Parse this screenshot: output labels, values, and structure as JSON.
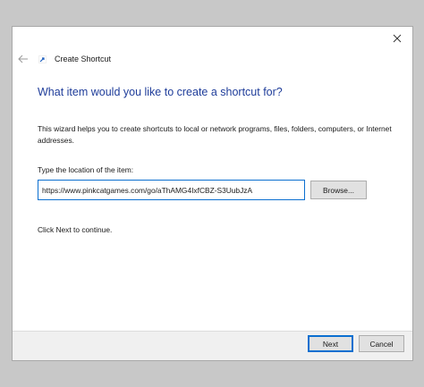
{
  "window": {
    "title": "Create Shortcut",
    "back_icon": "back-arrow-icon",
    "app_icon": "shortcut-icon",
    "close_icon": "close-icon"
  },
  "main": {
    "heading": "What item would you like to create a shortcut for?",
    "description": "This wizard helps you to create shortcuts to local or network programs, files, folders, computers, or Internet addresses.",
    "location_label": "Type the location of the item:",
    "location_value": "https://www.pinkcatgames.com/go/aThAMG4IxfCBZ-S3UubJzA",
    "browse_label": "Browse...",
    "hint": "Click Next to continue."
  },
  "footer": {
    "next_label": "Next",
    "cancel_label": "Cancel"
  },
  "colors": {
    "heading": "#1f3d9a",
    "focus_border": "#0b6fd0",
    "footer_bg": "#f0f0f0",
    "backdrop": "#c8c8c8"
  }
}
